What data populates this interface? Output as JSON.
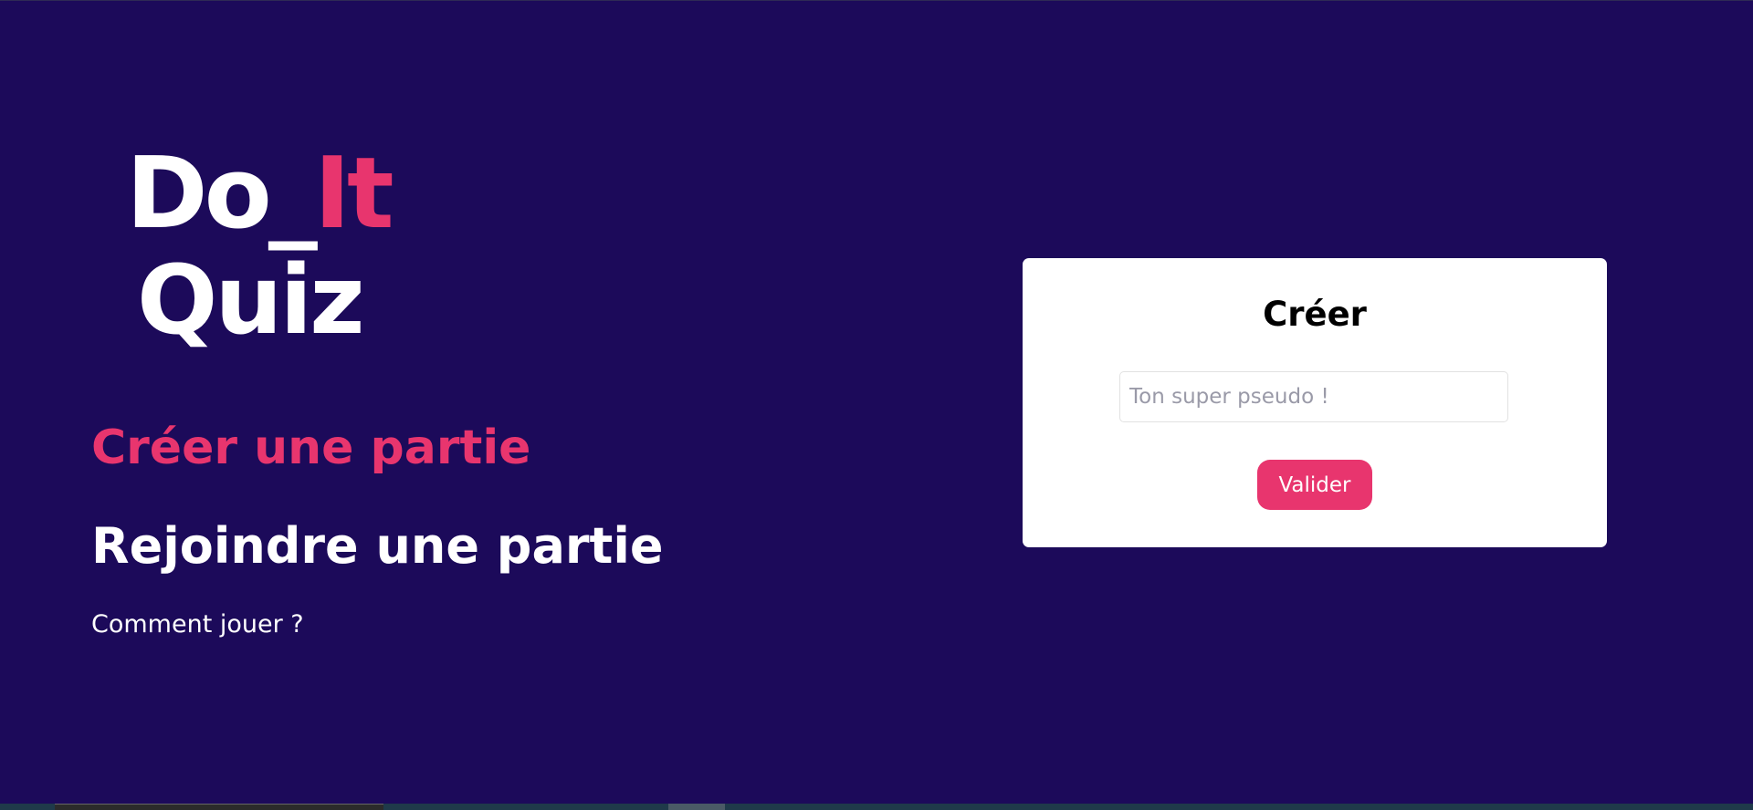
{
  "logo": {
    "line1_prefix": "Do_",
    "line1_accent": "It",
    "line2": "Quiz"
  },
  "menu": {
    "create_label": "Créer une partie",
    "join_label": "Rejoindre une partie",
    "howto_label": "Comment jouer ?"
  },
  "card": {
    "title": "Créer",
    "pseudo_placeholder": "Ton super pseudo !",
    "pseudo_value": "",
    "submit_label": "Valider"
  },
  "colors": {
    "background": "#1c0a5a",
    "accent": "#e8356e",
    "text_light": "#ffffff",
    "card_bg": "#ffffff"
  }
}
